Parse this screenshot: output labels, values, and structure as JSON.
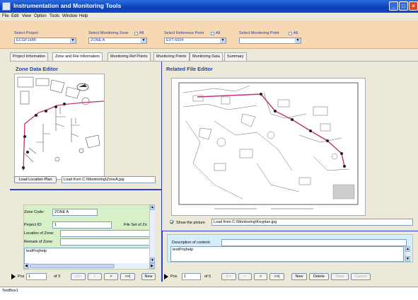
{
  "window": {
    "title": "Instrumentation and Monitoring Tools"
  },
  "menu": [
    "File",
    "Edit",
    "View",
    "Option",
    "Tools",
    "Window",
    "Help"
  ],
  "selection": {
    "project": {
      "label": "Select Project",
      "value": "ECGP1988"
    },
    "zone": {
      "label": "Select Monitoring Zone",
      "all_label": "All",
      "value": "ZONE A"
    },
    "ref_point": {
      "label": "Select Reference Point",
      "all_label": "All",
      "value": "EXT-6604"
    },
    "mon_point": {
      "label": "Select Monitoring Point",
      "all_label": "All",
      "value": ""
    }
  },
  "tabs": [
    "Project Information",
    "Zone and File Information",
    "Monitoring Ref Points",
    "Monitoring Points",
    "Monitoring Data",
    "Summary"
  ],
  "active_tab": 1,
  "zone_editor": {
    "title": "Zone Data Editor",
    "load_button": "Load Location Plan",
    "load_path": "Load from C:\\Monitoring\\ZoneA.jpg"
  },
  "zone_form": {
    "zone_code_label": "Zone Code:",
    "zone_code": "ZONE A",
    "project_id_label": "Project ID:",
    "project_id": "1",
    "file_set_label": "File Set of Zo",
    "location_label": "Location of Zone:",
    "location": "",
    "remark_label": "Remark of Zone:",
    "remark": "",
    "help_text": "textProjhelp"
  },
  "zone_nav": {
    "pos_label": "Pos",
    "pos": "1",
    "of": "of 3",
    "first": "|<<",
    "prev": "<",
    "next": ">",
    "last": ">>|",
    "new": "New"
  },
  "file_editor": {
    "title": "Related File Editor",
    "show_picture_label": "Show the picture",
    "show_picture_checked": true,
    "load_path": "Load from C:\\Monitoring\\Keyplan.jpg",
    "description_label": "Description of content:",
    "description": "",
    "help_text": "textProjhelp"
  },
  "file_nav": {
    "pos_label": "Pos",
    "pos": "1",
    "of": "of 5",
    "first": "|<<",
    "prev": "<",
    "next": ">",
    "last": ">>|",
    "new": "New",
    "delete": "Delete",
    "save": "Save",
    "cancel": "Cancel"
  },
  "textbox1": "TextBox1",
  "colors": {
    "titlebar": "#0a3fb8",
    "selection_panel": "#f6d8b2",
    "zone_form_bg": "#d8f0c8",
    "desc_panel_bg": "#d6ecf6",
    "accent_line": "#2a3fd0",
    "route_line": "#c0307a"
  }
}
